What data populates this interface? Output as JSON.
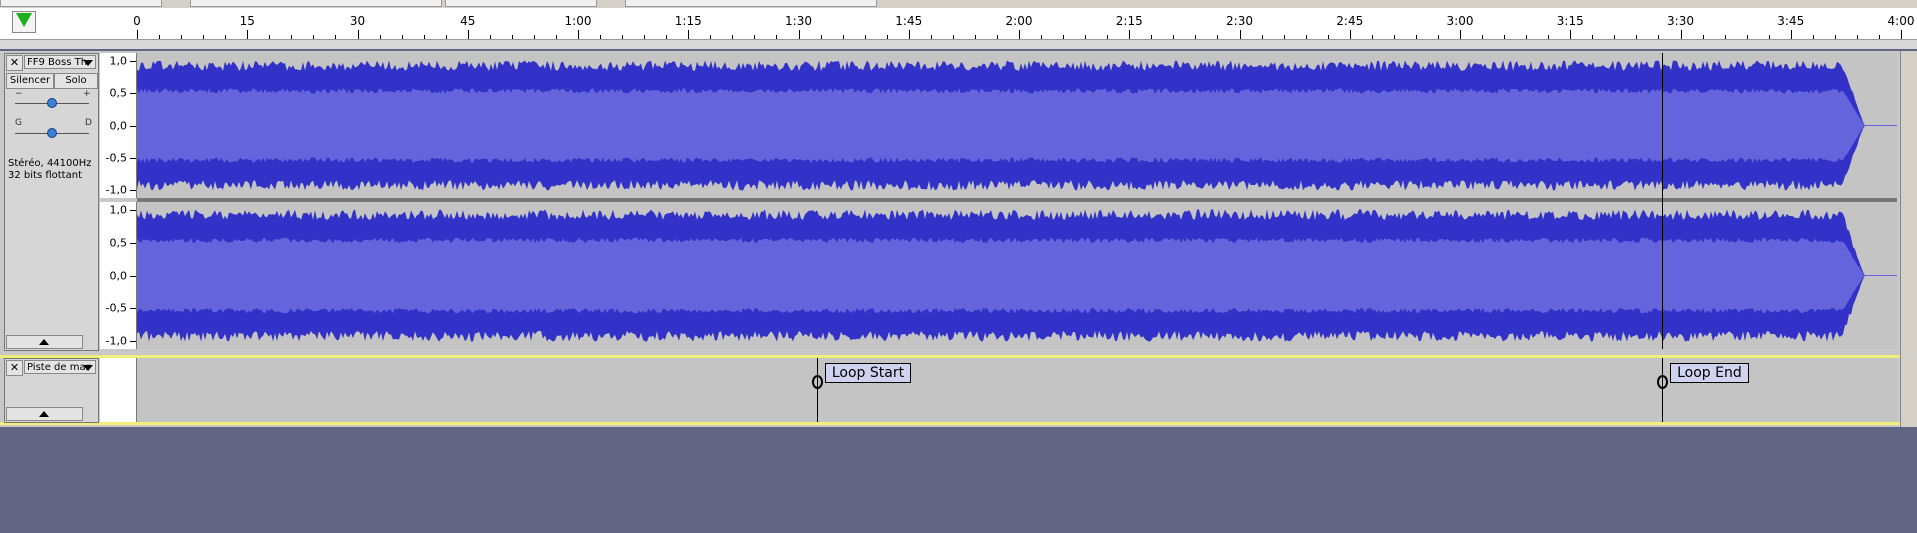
{
  "ruler": {
    "ticks": [
      {
        "label": "0",
        "seconds": 0
      },
      {
        "label": "15",
        "seconds": 15
      },
      {
        "label": "30",
        "seconds": 30
      },
      {
        "label": "45",
        "seconds": 45
      },
      {
        "label": "1:00",
        "seconds": 60
      },
      {
        "label": "1:15",
        "seconds": 75
      },
      {
        "label": "1:30",
        "seconds": 90
      },
      {
        "label": "1:45",
        "seconds": 105
      },
      {
        "label": "2:00",
        "seconds": 120
      },
      {
        "label": "2:15",
        "seconds": 135
      },
      {
        "label": "2:30",
        "seconds": 150
      },
      {
        "label": "2:45",
        "seconds": 165
      },
      {
        "label": "3:00",
        "seconds": 180
      },
      {
        "label": "3:15",
        "seconds": 195
      },
      {
        "label": "3:30",
        "seconds": 210
      },
      {
        "label": "3:45",
        "seconds": 225
      },
      {
        "label": "4:00",
        "seconds": 240
      }
    ]
  },
  "audio_track": {
    "name": "FF9 Boss Th",
    "mute_label": "Silencer",
    "solo_label": "Solo",
    "gain_minus": "−",
    "gain_plus": "+",
    "pan_left": "G",
    "pan_right": "D",
    "info_line1": "Stéréo, 44100Hz",
    "info_line2": "32 bits flottant",
    "scale_labels": [
      "1,0",
      "0,5",
      "0,0",
      "-0,5",
      "-1,0"
    ],
    "channels": 2,
    "wave_color": "#3232c8",
    "rms_color": "#6464dc",
    "background_color": "#c4c4c4"
  },
  "label_track": {
    "name": "Piste de mar",
    "labels": [
      {
        "text": "Loop Start",
        "seconds": 92.5
      },
      {
        "text": "Loop End",
        "seconds": 207.5
      }
    ],
    "border_color": "#f1ef7a"
  },
  "close_glyph": "✕"
}
